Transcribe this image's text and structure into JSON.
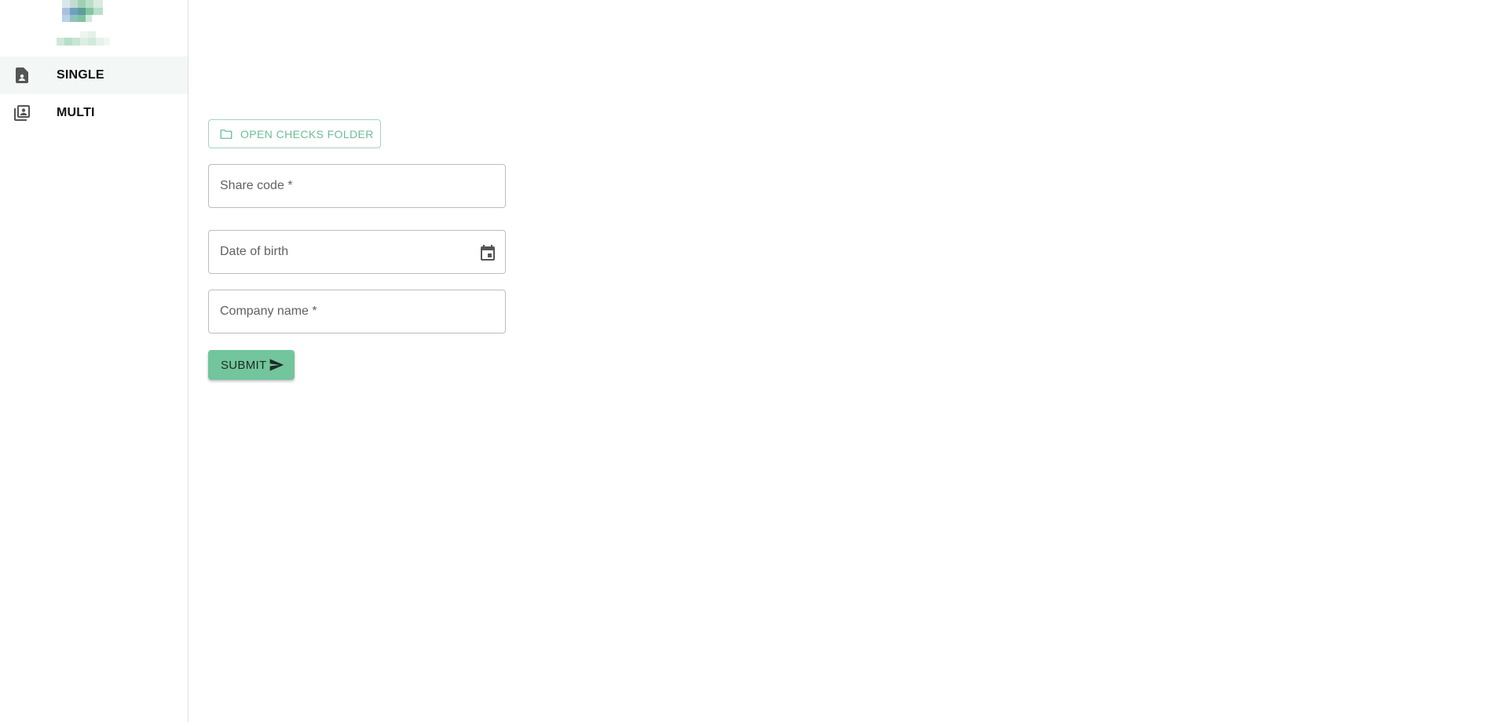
{
  "sidebar": {
    "logo_icon": "pixelated-logo-icon",
    "items": [
      {
        "label": "SINGLE",
        "icon": "person-document-icon",
        "active": true
      },
      {
        "label": "MULTI",
        "icon": "stacked-people-icon",
        "active": false
      }
    ]
  },
  "main": {
    "folder_button": {
      "label": "OPEN CHECKS FOLDER",
      "icon": "folder-outline-icon"
    },
    "fields": {
      "share_code": {
        "placeholder": "Share code *",
        "value": ""
      },
      "date_of_birth": {
        "placeholder": "Date of birth",
        "value": "",
        "icon": "calendar-icon"
      },
      "company_name": {
        "placeholder": "Company name *",
        "value": ""
      }
    },
    "submit_button": {
      "label": "SUBMIT",
      "icon": "send-icon"
    }
  },
  "colors": {
    "accent": "#72c59c",
    "outline_accent": "#a6d3bd",
    "accent_text": "#6cbf96",
    "active_nav_bg": "#f3f7f6"
  }
}
